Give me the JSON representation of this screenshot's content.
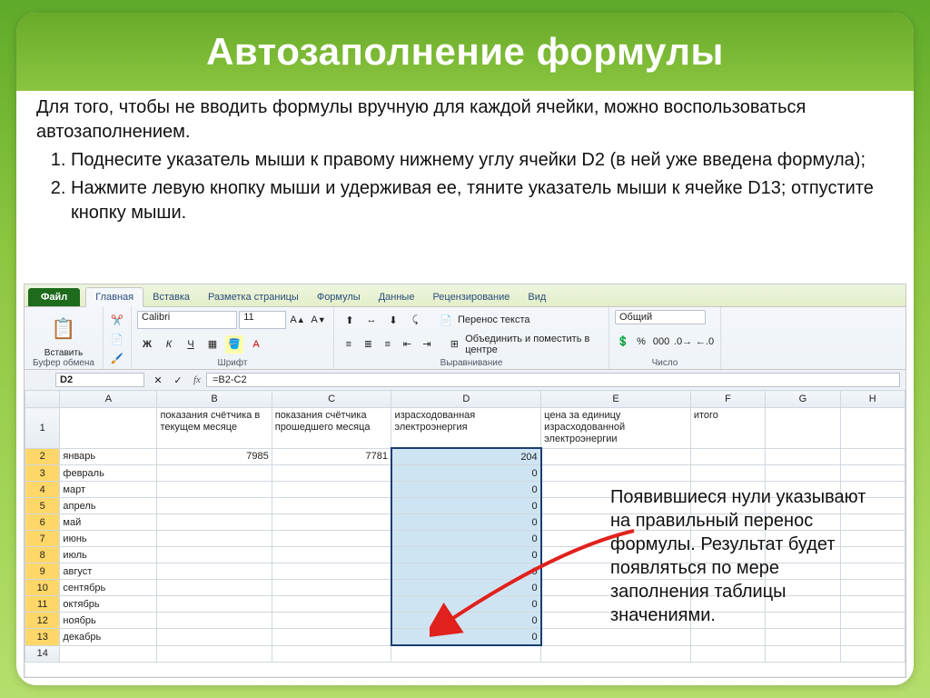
{
  "title": "Автозаполнение формулы",
  "intro": "Для того, чтобы не вводить формулы вручную для каждой ячейки, можно воспользоваться автозаполнением.",
  "steps": [
    "Поднесите указатель мыши к правому нижнему углу ячейки D2 (в ней уже введена формула);",
    "Нажмите левую кнопку мыши и удерживая ее, тяните указатель мыши к ячейке D13; отпустите кнопку мыши."
  ],
  "excel": {
    "file_tab": "Файл",
    "tabs": [
      "Главная",
      "Вставка",
      "Разметка страницы",
      "Формулы",
      "Данные",
      "Рецензирование",
      "Вид"
    ],
    "active_tab": 0,
    "paste_label": "Вставить",
    "clipboard_group": "Буфер обмена",
    "font_group": "Шрифт",
    "align_group": "Выравнивание",
    "number_group": "Число",
    "font_name": "Calibri",
    "font_size": "11",
    "wrap_label": "Перенос текста",
    "merge_label": "Объединить и поместить в центре",
    "number_format": "Общий",
    "namebox": "D2",
    "formula": "=B2-C2",
    "columns": [
      "",
      "A",
      "B",
      "C",
      "D",
      "E",
      "F",
      "G",
      "H"
    ],
    "headers": {
      "A": "",
      "B": "показания счётчика в текущем месяце",
      "C": "показания счётчика прошедшего месяца",
      "D": "израсходованная электроэнергия",
      "E": "цена за единицу израсходованной электроэнергии",
      "F": "итого"
    },
    "rows": [
      {
        "n": 2,
        "A": "январь",
        "B": "7985",
        "C": "7781",
        "D": "204"
      },
      {
        "n": 3,
        "A": "февраль",
        "D": "0"
      },
      {
        "n": 4,
        "A": "март",
        "D": "0"
      },
      {
        "n": 5,
        "A": "апрель",
        "D": "0"
      },
      {
        "n": 6,
        "A": "май",
        "D": "0"
      },
      {
        "n": 7,
        "A": "июнь",
        "D": "0"
      },
      {
        "n": 8,
        "A": "июль",
        "D": "0"
      },
      {
        "n": 9,
        "A": "август",
        "D": "0"
      },
      {
        "n": 10,
        "A": "сентябрь",
        "D": "0"
      },
      {
        "n": 11,
        "A": "октябрь",
        "D": "0"
      },
      {
        "n": 12,
        "A": "ноябрь",
        "D": "0"
      },
      {
        "n": 13,
        "A": "декабрь",
        "D": "0"
      },
      {
        "n": 14
      }
    ]
  },
  "annotation": "Появившиеся нули указывают на правильный перенос формулы. Результат будет появляться по мере заполнения таблицы значениями."
}
